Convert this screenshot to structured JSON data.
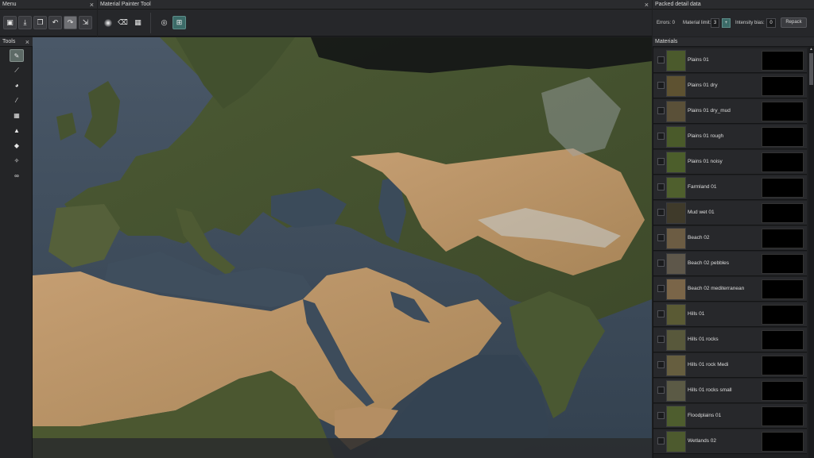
{
  "menu": {
    "title": "Menu"
  },
  "painter": {
    "title": "Material Painter Tool"
  },
  "tools": {
    "title": "Tools"
  },
  "packed": {
    "title": "Packed detail data",
    "errors_label": "Errors: 0",
    "limit_label": "Material limit:",
    "limit_value": "3",
    "intensity_label": "Intensity bias:",
    "intensity_value": "0",
    "repack_label": "Repack"
  },
  "materials": {
    "title": "Materials",
    "items": [
      {
        "label": "Plains 01",
        "color": "#4b5a2c"
      },
      {
        "label": "Plains 01 dry",
        "color": "#5e5231"
      },
      {
        "label": "Plains 01 dry_mud",
        "color": "#5a5038"
      },
      {
        "label": "Plains 01 rough",
        "color": "#4a5a2a"
      },
      {
        "label": "Plains 01 noisy",
        "color": "#4c5e2b"
      },
      {
        "label": "Farmland 01",
        "color": "#4f5f2d"
      },
      {
        "label": "Mud wet 01",
        "color": "#3f3a2a"
      },
      {
        "label": "Beach 02",
        "color": "#6c5c43"
      },
      {
        "label": "Beach 02 pebbles",
        "color": "#5e574a"
      },
      {
        "label": "Beach 02 mediterranean",
        "color": "#7a6548"
      },
      {
        "label": "Hills 01",
        "color": "#5a5a34"
      },
      {
        "label": "Hills 01 rocks",
        "color": "#58583b"
      },
      {
        "label": "Hills 01 rock Medi",
        "color": "#665e3f"
      },
      {
        "label": "Hills 01 rocks small",
        "color": "#5b5a45"
      },
      {
        "label": "Floodplains 01",
        "color": "#4e5d2e"
      },
      {
        "label": "Wetlands 02",
        "color": "#4d5a2e"
      }
    ]
  },
  "icons": {
    "menu": [
      "save-icon",
      "download-icon",
      "copy-icon",
      "undo-icon",
      "redo-icon",
      "export-icon"
    ],
    "painter": [
      "soft-brush-icon",
      "eraser-icon",
      "grid-select-icon",
      "target-icon",
      "overlay-icon"
    ],
    "tools": [
      "brush-icon",
      "paint-brush-icon",
      "palette-icon",
      "eyedropper-icon",
      "grid-icon",
      "mountain-icon",
      "shapes-icon",
      "wand-icon",
      "mask-icon"
    ]
  },
  "colors": {
    "panel": "#26272a",
    "accent": "#3c6b68",
    "water": "#3e4c5a",
    "desert": "#b8946a",
    "forest": "#465330"
  }
}
